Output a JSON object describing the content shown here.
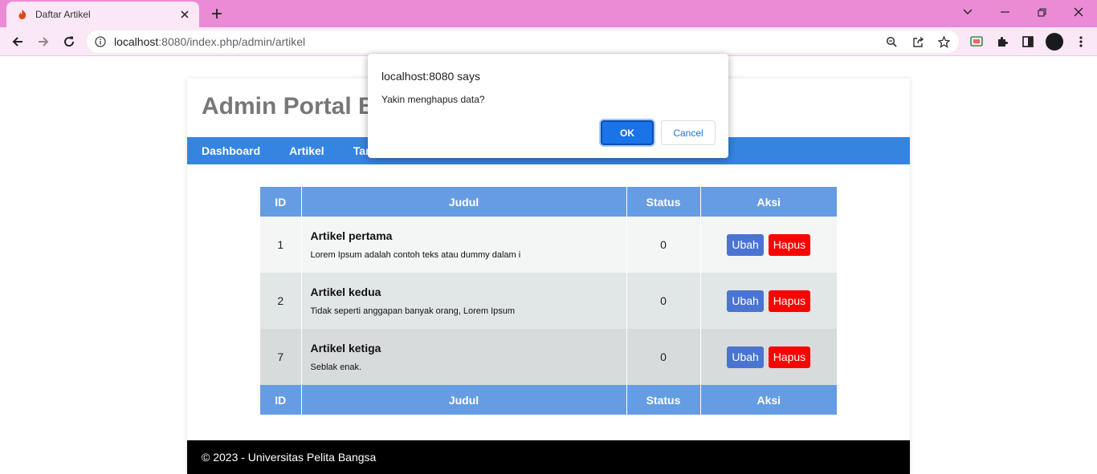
{
  "browser": {
    "tab_title": "Daftar Artikel",
    "url_host": "localhost",
    "url_rest": ":8080/index.php/admin/artikel",
    "accent": "#eb8bd6",
    "icons": [
      "back-icon",
      "forward-icon",
      "reload-icon",
      "info-icon",
      "zoom-icon",
      "share-icon",
      "bookmark-star-icon",
      "cast-icon",
      "extensions-icon",
      "side-panel-icon",
      "profile-avatar"
    ]
  },
  "site": {
    "title": "Admin Portal Berita",
    "nav": [
      {
        "label": "Dashboard"
      },
      {
        "label": "Artikel"
      },
      {
        "label": "Tambah Artikel"
      }
    ],
    "nav_color": "#3585e0"
  },
  "table": {
    "headers": {
      "id": "ID",
      "judul": "Judul",
      "status": "Status",
      "aksi": "Aksi"
    },
    "rows": [
      {
        "id": "1",
        "title": "Artikel pertama",
        "excerpt": "Lorem Ipsum adalah contoh teks atau dummy dalam i",
        "status": "0",
        "edit": "Ubah",
        "delete": "Hapus"
      },
      {
        "id": "2",
        "title": "Artikel kedua",
        "excerpt": "Tidak seperti anggapan banyak orang, Lorem Ipsum",
        "status": "0",
        "edit": "Ubah",
        "delete": "Hapus"
      },
      {
        "id": "7",
        "title": "Artikel ketiga",
        "excerpt": "Seblak enak.",
        "status": "0",
        "edit": "Ubah",
        "delete": "Hapus"
      }
    ]
  },
  "footer": {
    "text": "© 2023 - Universitas Pelita Bangsa"
  },
  "dialog": {
    "title": "localhost:8080 says",
    "message": "Yakin menghapus data?",
    "ok": "OK",
    "cancel": "Cancel"
  }
}
